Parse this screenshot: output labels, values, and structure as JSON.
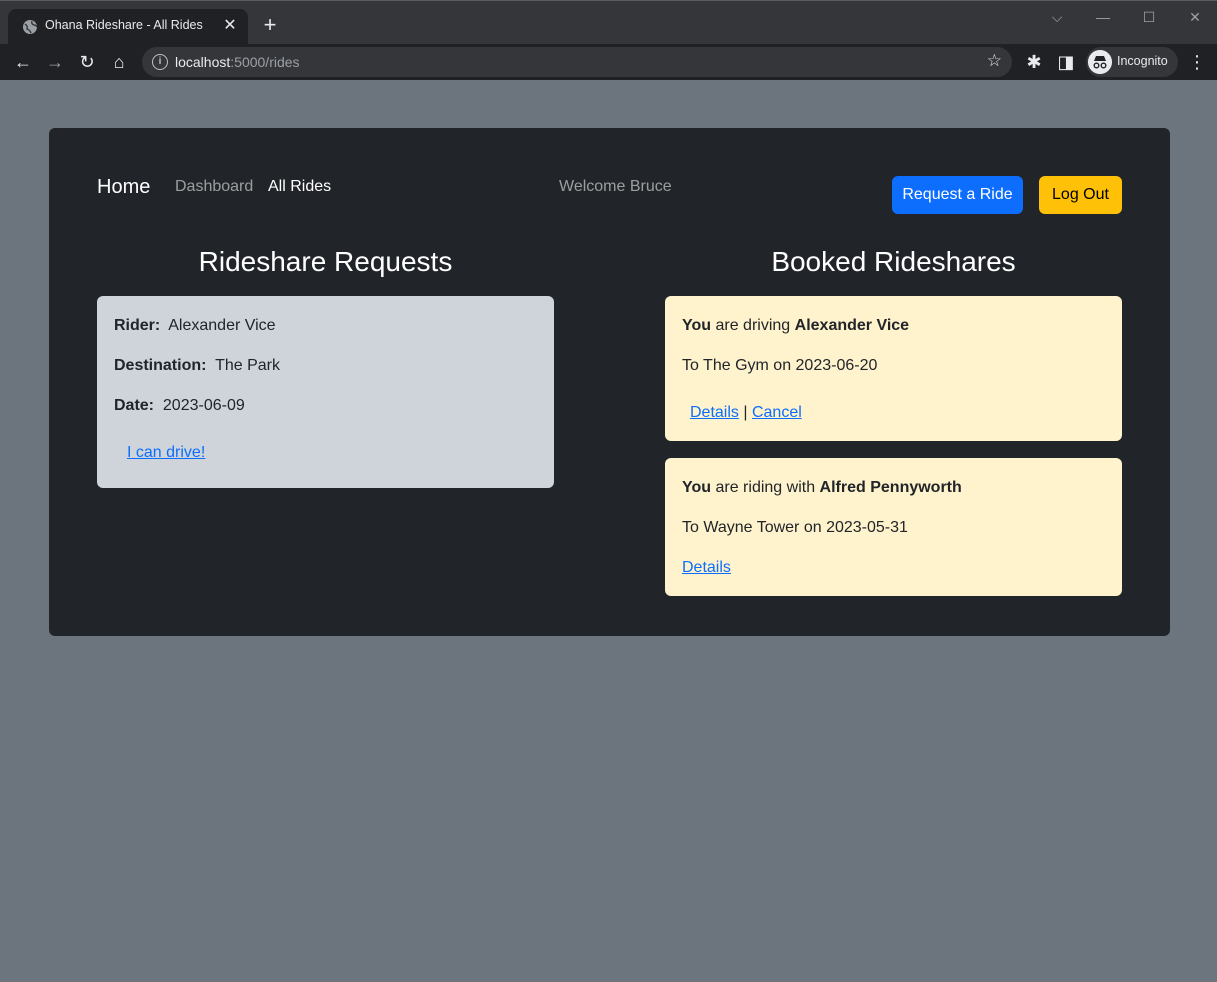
{
  "browser": {
    "tab_title": "Ohana Rideshare - All Rides",
    "url_host": "localhost",
    "url_path": ":5000/rides",
    "profile_label": "Incognito"
  },
  "nav": {
    "brand": "Home",
    "links": [
      "Dashboard",
      "All Rides"
    ],
    "active_link": "All Rides",
    "welcome": "Welcome Bruce",
    "request_button": "Request a Ride",
    "logout_button": "Log Out"
  },
  "requests": {
    "title": "Rideshare Requests",
    "items": [
      {
        "rider_label": "Rider:",
        "rider": "Alexander Vice",
        "destination_label": "Destination:",
        "destination": "The Park",
        "date_label": "Date:",
        "date": "2023-06-09",
        "action": "I can drive!"
      }
    ]
  },
  "booked": {
    "title": "Booked Rideshares",
    "items": [
      {
        "subject": "You",
        "verb": "are driving",
        "partner": "Alexander Vice",
        "trip": "To The Gym on 2023-06-20",
        "details_link": "Details",
        "separator": "|",
        "cancel_link": "Cancel"
      },
      {
        "subject": "You",
        "verb": "are riding with",
        "partner": "Alfred Pennyworth",
        "trip": "To Wayne Tower on 2023-05-31",
        "details_link": "Details"
      }
    ]
  },
  "colors": {
    "page_bg": "#6c757d",
    "panel_bg": "#212529",
    "primary": "#0d6efd",
    "warning": "#ffc107",
    "request_card": "#ced4da",
    "booked_card": "#fff3cd"
  }
}
